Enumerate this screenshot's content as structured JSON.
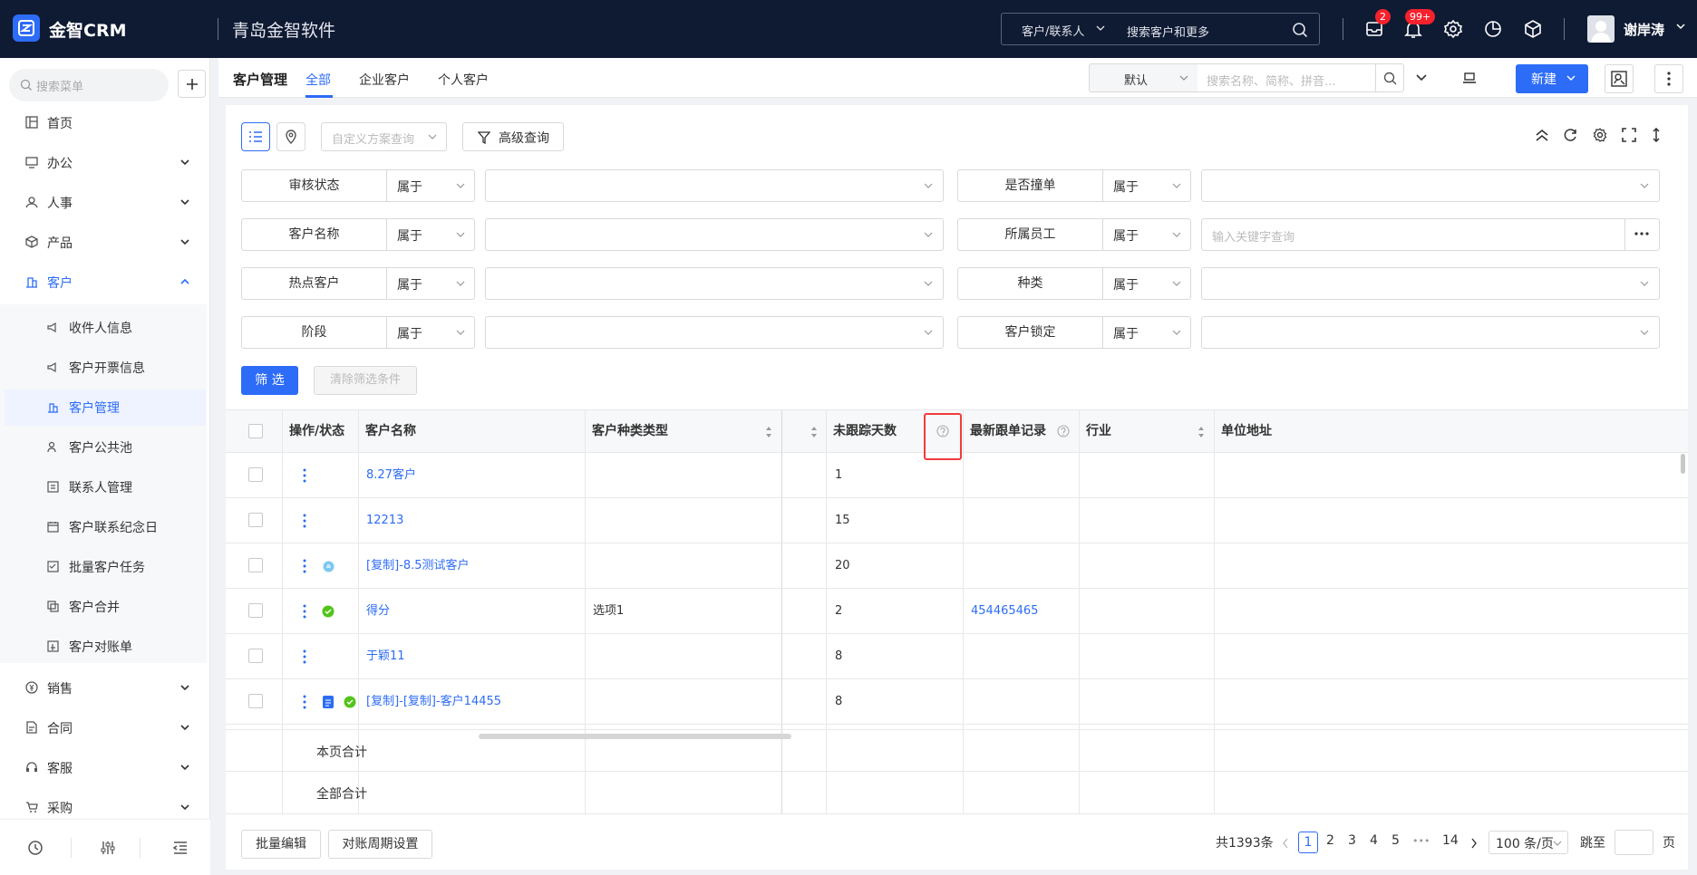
{
  "app": {
    "brand": "金智CRM",
    "company": "青岛金智软件"
  },
  "topbar": {
    "search_scope": "客户/联系人",
    "search_placeholder": "搜索客户和更多",
    "mail_badge": "2",
    "notice_badge": "99+",
    "user_name": "谢岸涛"
  },
  "sidebar": {
    "search_placeholder": "搜索菜单",
    "items": [
      {
        "label": "首页"
      },
      {
        "label": "办公"
      },
      {
        "label": "人事"
      },
      {
        "label": "产品"
      },
      {
        "label": "客户"
      },
      {
        "label": "销售"
      },
      {
        "label": "合同"
      },
      {
        "label": "客服"
      },
      {
        "label": "采购"
      }
    ],
    "sub_items": [
      {
        "label": "收件人信息"
      },
      {
        "label": "客户开票信息"
      },
      {
        "label": "客户管理"
      },
      {
        "label": "客户公共池"
      },
      {
        "label": "联系人管理"
      },
      {
        "label": "客户联系纪念日"
      },
      {
        "label": "批量客户任务"
      },
      {
        "label": "客户合并"
      },
      {
        "label": "客户对账单"
      }
    ]
  },
  "page": {
    "title": "客户管理",
    "tabs": [
      {
        "label": "全部"
      },
      {
        "label": "企业客户"
      },
      {
        "label": "个人客户"
      }
    ],
    "view_select": "默认",
    "search_placeholder": "搜索名称、简称、拼音...",
    "new_button": "新建"
  },
  "toolbar": {
    "scheme_placeholder": "自定义方案查询",
    "advanced_query": "高级查询"
  },
  "filters": {
    "left": [
      {
        "label": "审核状态",
        "op": "属于"
      },
      {
        "label": "客户名称",
        "op": "属于"
      },
      {
        "label": "热点客户",
        "op": "属于"
      },
      {
        "label": "阶段",
        "op": "属于"
      }
    ],
    "right": [
      {
        "label": "是否撞单",
        "op": "属于"
      },
      {
        "label": "所属员工",
        "op": "属于",
        "placeholder": "输入关键字查询"
      },
      {
        "label": "种类",
        "op": "属于"
      },
      {
        "label": "客户锁定",
        "op": "属于"
      }
    ],
    "filter_button": "筛 选",
    "clear_button": "清除筛选条件"
  },
  "table": {
    "headers": {
      "action": "操作/状态",
      "name": "客户名称",
      "type": "客户种类类型",
      "days": "未跟踪天数",
      "latest": "最新跟单记录",
      "industry": "行业",
      "address": "单位地址"
    },
    "rows": [
      {
        "name": "8.27客户",
        "type": "",
        "days": "1",
        "latest": "",
        "icons": []
      },
      {
        "name": "12213",
        "type": "",
        "days": "15",
        "latest": "",
        "icons": []
      },
      {
        "name": "[复制]-8.5测试客户",
        "type": "",
        "days": "20",
        "latest": "",
        "icons": [
          "approved-icon"
        ]
      },
      {
        "name": "得分",
        "type": "选项1",
        "days": "2",
        "latest": "454465465",
        "icons": [
          "check-circle-icon"
        ]
      },
      {
        "name": "于颖11",
        "type": "",
        "days": "8",
        "latest": "",
        "icons": []
      },
      {
        "name": "[复制]-[复制]-客户14455",
        "type": "",
        "days": "8",
        "latest": "",
        "icons": [
          "document-icon",
          "check-circle-icon"
        ]
      }
    ],
    "summary": {
      "page_total": "本页合计",
      "all_total": "全部合计"
    }
  },
  "footer": {
    "batch_edit": "批量编辑",
    "period_setting": "对账周期设置",
    "total": "共1393条",
    "pages": [
      "1",
      "2",
      "3",
      "4",
      "5",
      "14"
    ],
    "ellipsis": "•••",
    "page_size": "100 条/页",
    "goto_label": "跳至",
    "page_suffix": "页"
  },
  "colors": {
    "primary": "#2d6cf6",
    "topbar": "#0f1a33",
    "badge": "#f5222d",
    "success": "#52c41a"
  }
}
